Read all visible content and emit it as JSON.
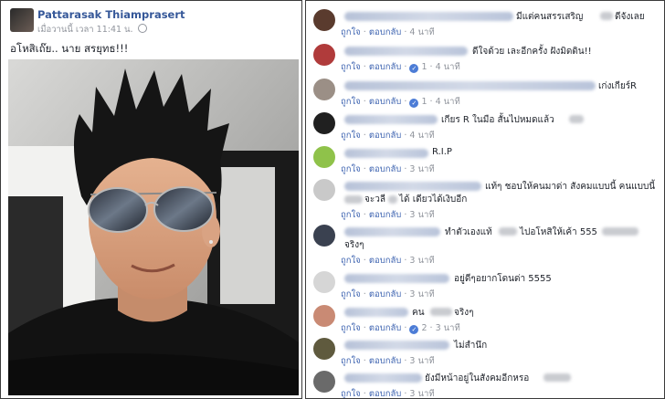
{
  "post": {
    "author": "Pattarasak Thiamprasert",
    "time": "เมื่อวานนี้ เวลา 11:41 น.",
    "caption": "อโหสิเถ๊ย.. นาย สรยุทธ!!!"
  },
  "comment_ui": {
    "like": "ถูกใจ",
    "reply": "ตอบกลับ",
    "separator": "·"
  },
  "comments": [
    {
      "text": "มีแต่คนสรรเสริญ",
      "text_b": "ดีจังเลย",
      "time": "4 นาที",
      "likes": ""
    },
    {
      "text": "ดีใจด้วย เละอีกครั้ง ฝังมิดดิน!!",
      "time": "4 นาที",
      "likes": "1"
    },
    {
      "text": "เก่งเกียร์R",
      "time": "4 นาที",
      "likes": "1"
    },
    {
      "text": "เกียร R ในมือ สั้นไปหมดแล้ว",
      "time": "4 นาที",
      "likes": ""
    },
    {
      "text": "R.I.P",
      "time": "3 นาที",
      "likes": ""
    },
    {
      "text": "แท้ๆ ชอบให้คนมาด่า สังคมแบบนี้ คนแบบนี้",
      "text2": "จะวลี",
      "text2b": "ได้ เดียวได้เงิบอีก",
      "time": "3 นาที",
      "likes": ""
    },
    {
      "text": "ทำตัวเองแท้",
      "text_b": "ไปอโหสิให้เค้า 555",
      "text2": "จริงๆ",
      "time": "3 นาที",
      "likes": ""
    },
    {
      "text": "อยู่ดีๆอยากโดนด่า 5555",
      "time": "3 นาที",
      "likes": ""
    },
    {
      "text": "คน",
      "text_b": "จริงๆ",
      "time": "3 นาที",
      "likes": "2"
    },
    {
      "text": "ไม่สำนึก",
      "time": "3 นาที",
      "likes": ""
    },
    {
      "text": "ยังมีหน้าอยู่ในสังคมอีกหรอ",
      "time": "3 นาที",
      "likes": ""
    }
  ]
}
